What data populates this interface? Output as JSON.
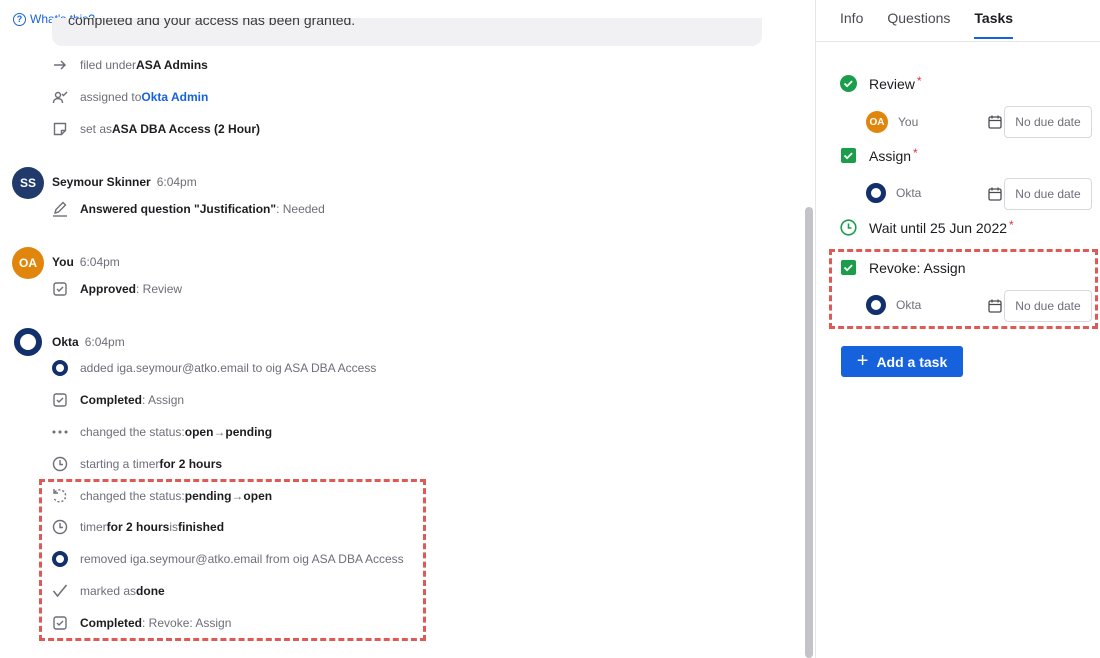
{
  "help_link": "What's this?",
  "truncated_message": "completed and your access has been granted.",
  "top_events": [
    {
      "prefix": "filed under ",
      "bold": "ASA Admins",
      "icon": "arrow-right-icon"
    },
    {
      "prefix": "assigned to ",
      "link": "Okta Admin",
      "icon": "assign-user-icon"
    },
    {
      "prefix": "set as ",
      "bold": "ASA DBA Access (2 Hour)",
      "icon": "note-icon"
    }
  ],
  "skinner": {
    "initials": "SS",
    "name": "Seymour Skinner",
    "time": "6:04pm",
    "event_bold": "Answered question \"Justification\"",
    "event_rest": ": Needed"
  },
  "you": {
    "initials": "OA",
    "name": "You",
    "time": "6:04pm",
    "event_bold": "Approved",
    "event_rest": ": Review"
  },
  "okta": {
    "name": "Okta",
    "time": "6:04pm",
    "events": {
      "added": "added iga.seymour@atko.email to oig ASA DBA Access",
      "completed_bold": "Completed",
      "completed_rest": ": Assign",
      "status1_prefix": "changed the status: ",
      "status1_from": "open",
      "status1_arrow": " → ",
      "status1_to": "pending",
      "timer_prefix": "starting a timer ",
      "timer_bold": "for 2 hours",
      "status2_prefix": "changed the status: ",
      "status2_from": "pending",
      "status2_arrow": " → ",
      "status2_to": "open",
      "timer2_prefix": "timer ",
      "timer2_bold": "for 2 hours",
      "timer2_mid": " is ",
      "timer2_end": "finished",
      "removed": "removed iga.seymour@atko.email from oig ASA DBA Access",
      "marked_prefix": "marked as ",
      "marked_bold": "done",
      "completed2_bold": "Completed",
      "completed2_rest": ": Revoke: Assign"
    }
  },
  "tabs": {
    "info": "Info",
    "questions": "Questions",
    "tasks": "Tasks",
    "active": "Tasks"
  },
  "tasks": [
    {
      "label": "Review",
      "required": "*",
      "assignee_initials": "OA",
      "assignee": "You",
      "due": "No due date",
      "status": "complete-circle"
    },
    {
      "label": "Assign",
      "required": "*",
      "assignee": "Okta",
      "due": "No due date",
      "status": "checked"
    },
    {
      "label": "Wait until 25 Jun 2022",
      "required": "*",
      "status": "clock"
    },
    {
      "label": "Revoke: Assign",
      "assignee": "Okta",
      "due": "No due date",
      "status": "checked"
    }
  ],
  "add_task": "Add a task",
  "colors": {
    "accent": "#1662dd",
    "success": "#1a9e4b",
    "highlight": "#e05a55",
    "navy": "#12306b",
    "orange": "#e0860c"
  }
}
